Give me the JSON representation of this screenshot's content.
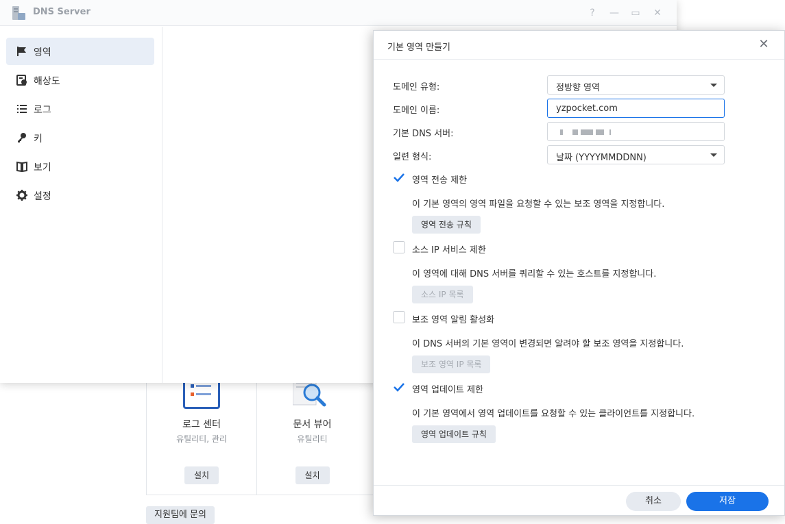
{
  "background": {
    "apps": [
      {
        "name": "로그 센터",
        "category": "유틸리티, 관리",
        "install_label": "설치",
        "icon": "log-center-icon"
      },
      {
        "name": "문서 뷰어",
        "category": "유틸리티",
        "install_label": "설치",
        "icon": "document-viewer-icon"
      }
    ],
    "contact_label": "지원팀에 문의"
  },
  "window": {
    "title": "DNS Server",
    "controls": {
      "help": "?",
      "minimize": "—",
      "maximize": "▭",
      "close": "✕"
    }
  },
  "sidebar": {
    "items": [
      {
        "label": "영역",
        "icon": "flag-icon",
        "active": true
      },
      {
        "label": "해상도",
        "icon": "resolution-icon",
        "active": false
      },
      {
        "label": "로그",
        "icon": "list-icon",
        "active": false
      },
      {
        "label": "키",
        "icon": "key-icon",
        "active": false
      },
      {
        "label": "보기",
        "icon": "book-icon",
        "active": false
      },
      {
        "label": "설정",
        "icon": "gear-icon",
        "active": false
      }
    ]
  },
  "dialog": {
    "title": "기본 영역 만들기",
    "fields": {
      "domain_type": {
        "label": "도메인 유형:",
        "value": "정방향 영역"
      },
      "domain_name": {
        "label": "도메인 이름:",
        "value": "yzpocket.com"
      },
      "primary_dns": {
        "label": "기본 DNS 서버:"
      },
      "serial_format": {
        "label": "일련 형식:",
        "value": "날짜 (YYYYMMDDNN)"
      }
    },
    "options": [
      {
        "label": "영역 전송 제한",
        "checked": true,
        "description": "이 기본 영역의 영역 파일을 요청할 수 있는 보조 영역을 지정합니다.",
        "button": "영역 전송 규칙",
        "button_enabled": true
      },
      {
        "label": "소스 IP 서비스 제한",
        "checked": false,
        "description": "이 영역에 대해 DNS 서버를 쿼리할 수 있는 호스트를 지정합니다.",
        "button": "소스 IP 목록",
        "button_enabled": false
      },
      {
        "label": "보조 영역 알림 활성화",
        "checked": false,
        "description": "이 DNS 서버의 기본 영역이 변경되면 알려야 할 보조 영역을 지정합니다.",
        "button": "보조 영역 IP 목록",
        "button_enabled": false
      },
      {
        "label": "영역 업데이트 제한",
        "checked": true,
        "description": "이 기본 영역에서 영역 업데이트를 요청할 수 있는 클라이언트를 지정합니다.",
        "button": "영역 업데이트 규칙",
        "button_enabled": true
      }
    ],
    "footer": {
      "cancel_label": "취소",
      "save_label": "저장"
    },
    "colors": {
      "accent": "#1a73e8"
    }
  }
}
